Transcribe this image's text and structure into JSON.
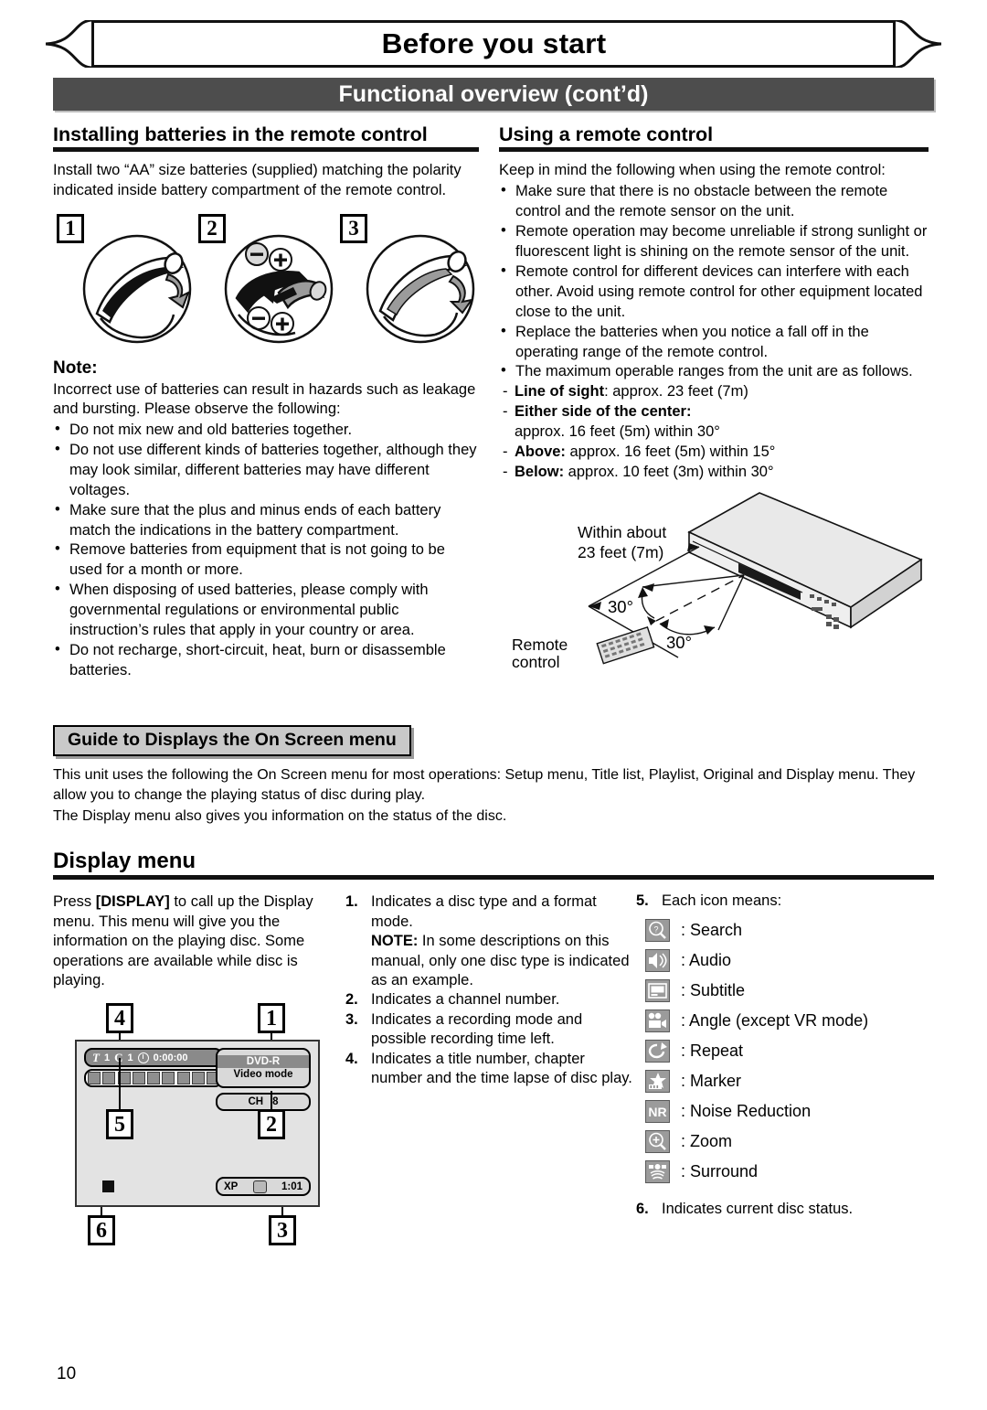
{
  "header": {
    "ribbon_title": "Before you start",
    "dark_bar_title": "Functional overview (cont’d)"
  },
  "left_section": {
    "heading": "Installing batteries in the remote control",
    "intro": "Install two “AA” size batteries (supplied) matching the polarity indicated inside battery compartment of the remote control.",
    "figure_numbers": [
      "1",
      "2",
      "3"
    ],
    "note_heading": "Note:",
    "note_intro": "Incorrect use of batteries can result in hazards such as leakage and bursting. Please observe the following:",
    "note_bullets": [
      "Do not mix new and old batteries together.",
      "Do not use different kinds of batteries together, although they may look similar, different batteries may have different voltages.",
      "Make sure that the plus and minus ends of each battery match the indications in the battery compartment.",
      "Remove batteries from equipment that is not going to be used for a month or more.",
      "When disposing of used batteries, please comply with governmental regulations or environmental public instruction’s rules that apply in your country or area.",
      "Do not recharge, short-circuit, heat, burn or disassemble batteries."
    ]
  },
  "right_section": {
    "heading": "Using a remote control",
    "intro": "Keep in mind the following when using the remote control:",
    "bullets": [
      "Make sure that there is no obstacle between the remote control and the remote sensor on the unit.",
      "Remote operation may become unreliable if strong sunlight or fluorescent light is shining on the remote sensor of the unit.",
      "Remote control for different devices can interfere with each other.  Avoid using remote control for other equipment located close to the unit.",
      "Replace the batteries when you notice a fall off in the operating range of the remote control.",
      "The maximum operable ranges from the unit are as follows."
    ],
    "ranges": [
      {
        "label": "Line of sight",
        "sep": ":",
        "value": " approx. 23 feet (7m)"
      },
      {
        "label": "Either side of the center:",
        "sep": "",
        "value": ""
      },
      {
        "label": "",
        "sep": "",
        "value": "approx. 16 feet (5m) within 30°"
      },
      {
        "label": "Above:",
        "sep": "",
        "value": " approx. 16 feet (5m) within 15°"
      },
      {
        "label": "Below:",
        "sep": "",
        "value": " approx. 10 feet (3m) within 30°"
      }
    ],
    "diagram": {
      "distance_label_line1": "Within about",
      "distance_label_line2": "23 feet (7m)",
      "angle_upper": "30°",
      "angle_lower": "30°",
      "remote_label_line1": "Remote",
      "remote_label_line2": "control"
    }
  },
  "guide_section": {
    "box_title": "Guide to Displays the On Screen menu",
    "paragraph_1": "This unit uses the following the On Screen menu for most operations: Setup menu, Title list, Playlist, Original and Display menu. They allow you to change the playing status of disc during play.",
    "paragraph_2": "The Display menu also gives you information on the status of the disc."
  },
  "display_menu": {
    "heading": "Display menu",
    "intro_pre": "Press ",
    "intro_bold": "[DISPLAY]",
    "intro_post": " to call up the Display menu. This menu will give you the information on the playing disc. Some operations are available while disc is playing.",
    "items": [
      {
        "n": "1.",
        "text": "Indicates a disc type and a format mode."
      },
      {
        "n": "",
        "bold": "NOTE:",
        "text": " In some descriptions on this manual, only one disc type is indicated as an example."
      },
      {
        "n": "2.",
        "text": "Indicates a channel number."
      },
      {
        "n": "3.",
        "text": "Indicates a recording mode and possible recording time left."
      },
      {
        "n": "4.",
        "text": "Indicates a title number, chapter number and the time lapse of disc play."
      }
    ],
    "icon_heading_n": "5.",
    "icon_heading": "Each icon means:",
    "icons": [
      {
        "icon": "search-icon",
        "label": ": Search"
      },
      {
        "icon": "audio-icon",
        "label": ": Audio"
      },
      {
        "icon": "subtitle-icon",
        "label": ": Subtitle"
      },
      {
        "icon": "angle-icon",
        "label": ": Angle (except VR mode)"
      },
      {
        "icon": "repeat-icon",
        "label": ": Repeat"
      },
      {
        "icon": "marker-icon",
        "label": ": Marker"
      },
      {
        "icon": "noise-reduction-icon",
        "label": ": Noise Reduction"
      },
      {
        "icon": "zoom-icon",
        "label": ": Zoom"
      },
      {
        "icon": "surround-icon",
        "label": ": Surround"
      }
    ],
    "final_n": "6.",
    "final_text": "Indicates current disc status.",
    "screen_mock": {
      "callouts": [
        "1",
        "2",
        "3",
        "4",
        "5",
        "6"
      ],
      "title_label": "T",
      "title_value": "1",
      "chapter_label": "C",
      "chapter_value": "1",
      "time_value": "0:00:00",
      "disc_type": "DVD-R",
      "disc_format": "Video mode",
      "channel_label": "CH",
      "channel_value": "8",
      "rec_mode": "XP",
      "rec_time": "1:01"
    }
  },
  "footer": {
    "page_number": "10"
  },
  "colors": {
    "dark_bar": "#4d4d4d",
    "guide_box": "#c9c9c9",
    "osd_gray": "#8a8a8a",
    "screen_bg": "#e3e3e3"
  }
}
